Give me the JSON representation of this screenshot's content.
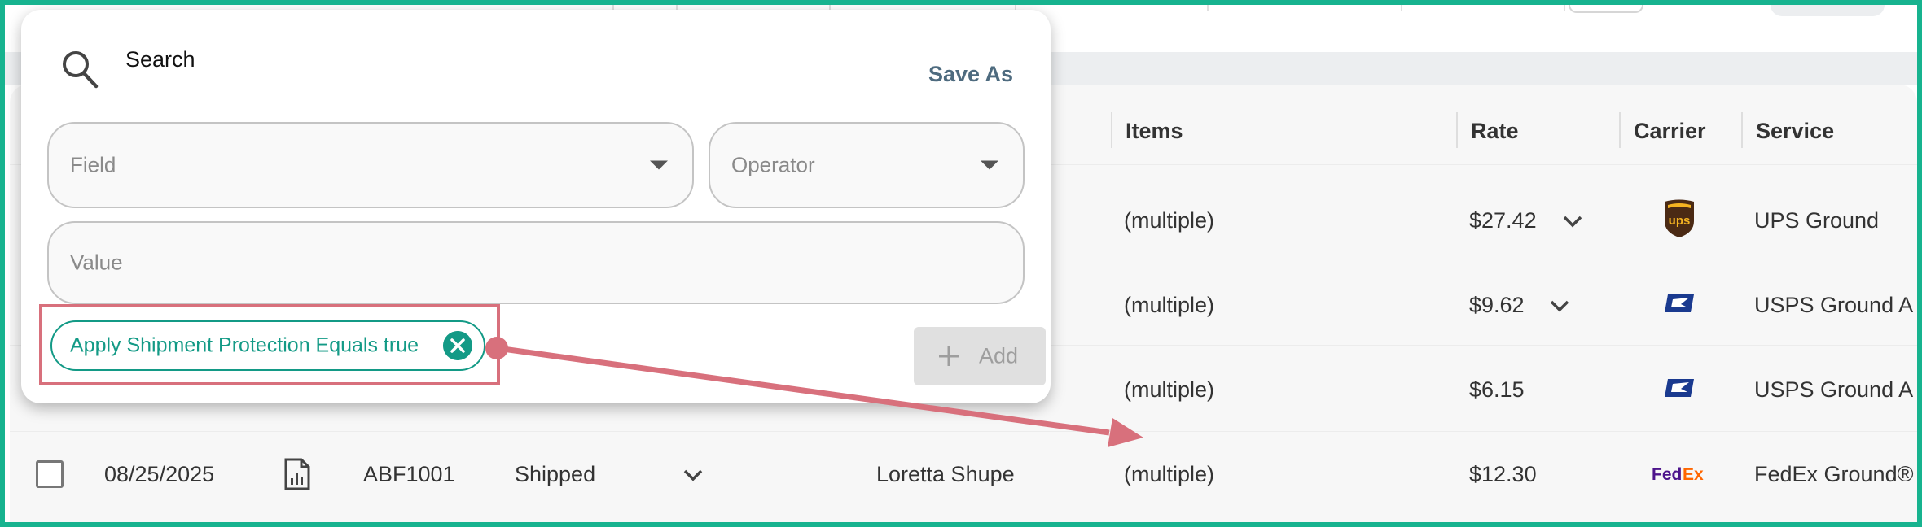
{
  "search": {
    "title": "Search",
    "save_as_label": "Save As",
    "field_placeholder": "Field",
    "operator_placeholder": "Operator",
    "value_placeholder": "Value",
    "add_label": "Add",
    "filter_chip": "Apply Shipment Protection Equals true"
  },
  "table": {
    "headers": {
      "items": "Items",
      "rate": "Rate",
      "carrier": "Carrier",
      "service": "Service"
    },
    "rows": [
      {
        "items": "(multiple)",
        "rate": "$27.42",
        "carrier_icon": "ups-logo",
        "service": "UPS Ground"
      },
      {
        "items": "(multiple)",
        "rate": "$9.62",
        "carrier_icon": "usps-logo",
        "service": "USPS Ground A"
      },
      {
        "items": "(multiple)",
        "rate": "$6.15",
        "carrier_icon": "usps-logo",
        "service": "USPS Ground A"
      },
      {
        "date": "08/25/2025",
        "order": "ABF1001",
        "status": "Shipped",
        "recipient": "Loretta Shupe",
        "items": "(multiple)",
        "rate": "$12.30",
        "carrier_icon": "fedex-logo",
        "service": "FedEx Ground®"
      }
    ]
  },
  "colors": {
    "accent": "#139a86",
    "frame": "#17b38f",
    "highlight": "#d8707c",
    "ups_brown": "#4b2a14",
    "ups_gold": "#f5b321",
    "usps_blue": "#1a3a8f",
    "fedex_purple": "#4d148c",
    "fedex_orange": "#ff6600"
  }
}
